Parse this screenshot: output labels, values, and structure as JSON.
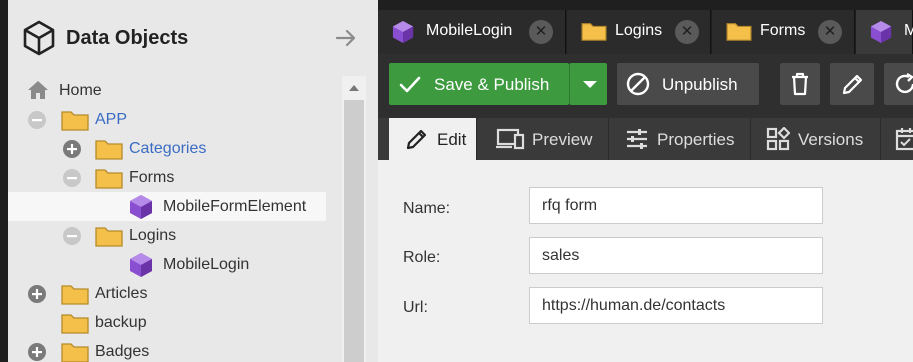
{
  "panel": {
    "title": "Data Objects",
    "icon": "cube-icon",
    "collapse_icon": "arrow-right-icon"
  },
  "tree": [
    {
      "label": "Home",
      "type": "home",
      "toggle": "none",
      "link": false
    },
    {
      "label": "APP",
      "type": "folder",
      "toggle": "minus",
      "link": true
    },
    {
      "label": "Categories",
      "type": "folder",
      "toggle": "plus",
      "link": true
    },
    {
      "label": "Forms",
      "type": "folder",
      "toggle": "minus",
      "link": false
    },
    {
      "label": "MobileFormElement",
      "type": "object",
      "toggle": "none",
      "link": false,
      "selected": true
    },
    {
      "label": "Logins",
      "type": "folder",
      "toggle": "minus",
      "link": false
    },
    {
      "label": "MobileLogin",
      "type": "object",
      "toggle": "none",
      "link": false
    },
    {
      "label": "Articles",
      "type": "folder",
      "toggle": "plus",
      "link": false
    },
    {
      "label": "backup",
      "type": "folder",
      "toggle": "none",
      "link": false
    },
    {
      "label": "Badges",
      "type": "folder",
      "toggle": "plus",
      "link": false
    }
  ],
  "tabs": [
    {
      "label": "MobileLogin",
      "icon": "cube-object-icon"
    },
    {
      "label": "Logins",
      "icon": "folder-icon"
    },
    {
      "label": "Forms",
      "icon": "folder-icon"
    },
    {
      "label": "M",
      "icon": "cube-object-icon"
    }
  ],
  "toolbar": {
    "save_label": "Save & Publish",
    "unpublish_label": "Unpublish"
  },
  "subtabs": [
    {
      "label": "Edit",
      "icon": "pencil-icon"
    },
    {
      "label": "Preview",
      "icon": "devices-icon"
    },
    {
      "label": "Properties",
      "icon": "sliders-icon"
    },
    {
      "label": "Versions",
      "icon": "versions-icon"
    }
  ],
  "form": {
    "name_label": "Name:",
    "name_value": "rfq form",
    "role_label": "Role:",
    "role_value": "sales",
    "url_label": "Url:",
    "url_value": "https://human.de/contacts"
  },
  "colors": {
    "accent_green": "#3d9a3f",
    "link_blue": "#3b6cc4",
    "folder_yellow": "#f4c04a",
    "object_purple": "#8a4fd0"
  }
}
